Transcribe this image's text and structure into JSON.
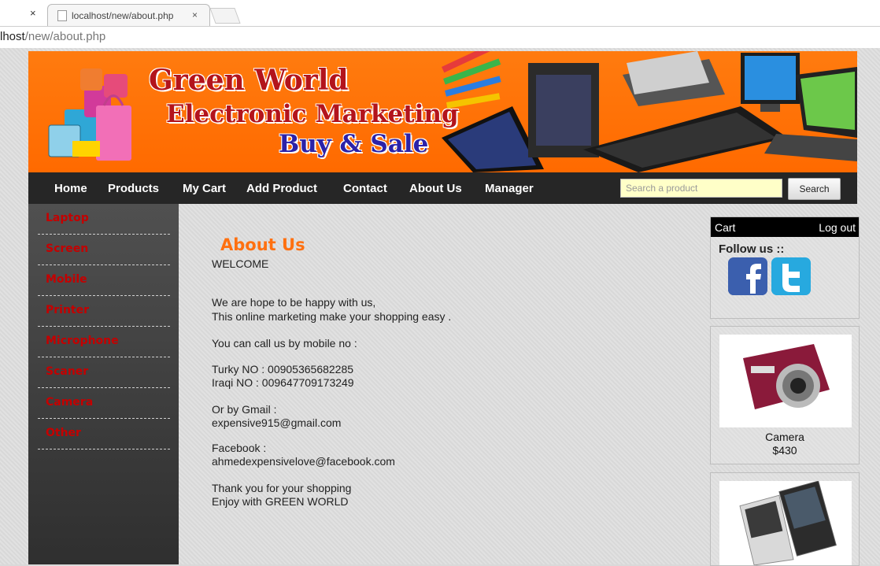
{
  "browser": {
    "tab_close": "×",
    "tab_title": "localhost/new/about.php",
    "tab_x": "×",
    "url_host": "lhost",
    "url_path": "/new/about.php"
  },
  "banner": {
    "line1": "Green World",
    "line2": "Electronic Marketing",
    "line3": "Buy & Sale",
    "brand_color": "#ff6a00"
  },
  "nav": {
    "items": [
      "Home",
      "Products",
      "My Cart",
      "Add Product",
      "Contact",
      "About Us",
      "Manager"
    ],
    "search_placeholder": "Search a product",
    "search_button": "Search"
  },
  "sidebar": {
    "categories": [
      "Laptop",
      "Screen",
      "Mobile",
      "Printer",
      "Microphone",
      "Scaner",
      "Camera",
      "Other"
    ]
  },
  "content": {
    "title": "About Us",
    "lines": [
      "WELCOME",
      "We are hope to be happy with us,",
      "This online marketing make your shopping easy .",
      "You can call us by mobile no :",
      "Turky NO : 00905365682285",
      "Iraqi NO : 009647709173249",
      "Or by Gmail :",
      "expensive915@gmail.com",
      "Facebook :",
      "ahmedexpensivelove@facebook.com",
      "Thank you for your shopping",
      "Enjoy with GREEN WORLD"
    ]
  },
  "right_panel": {
    "cart": "Cart",
    "logout": "Log out",
    "follow": "Follow us ::",
    "icons": [
      "facebook-icon",
      "twitter-icon"
    ]
  },
  "products": [
    {
      "name": "Camera",
      "price": "$430"
    },
    {
      "name": "",
      "price": ""
    }
  ]
}
